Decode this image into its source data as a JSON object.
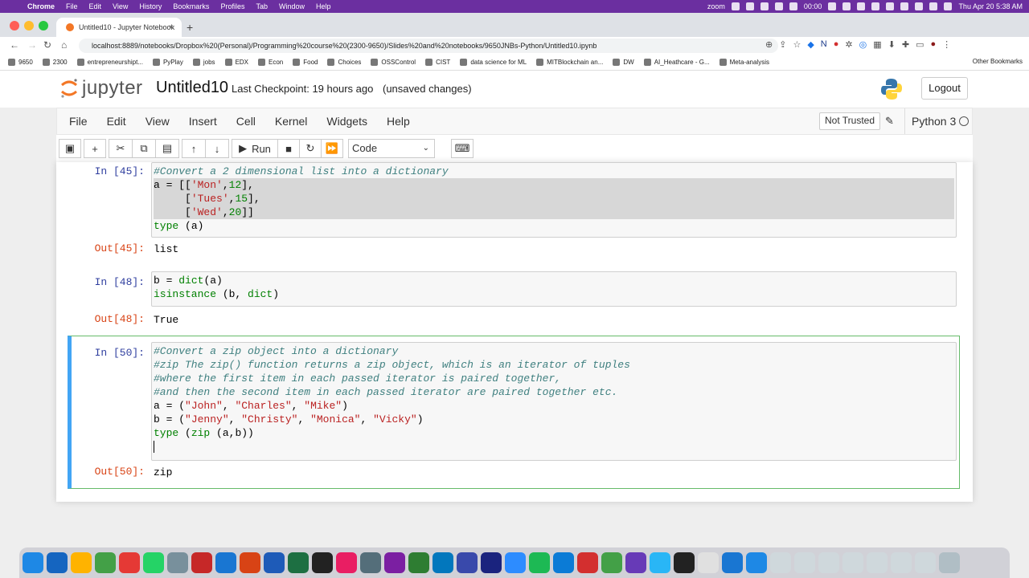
{
  "mac_menubar": {
    "app": "Chrome",
    "menus": [
      "File",
      "Edit",
      "View",
      "History",
      "Bookmarks",
      "Profiles",
      "Tab",
      "Window",
      "Help"
    ],
    "zoom_label": "zoom",
    "timer": "00:00",
    "datetime": "Thu Apr 20  5:38 AM"
  },
  "browser": {
    "tab_title": "Untitled10 - Jupyter Notebook",
    "url": "localhost:8889/notebooks/Dropbox%20(Personal)/Programming%20course%20(2300-9650)/Slides%20and%20notebooks/9650JNBs-Python/Untitled10.ipynb",
    "bookmarks": [
      "9650",
      "2300",
      "entrepreneurshipt...",
      "PyPlay",
      "jobs",
      "EDX",
      "Econ",
      "Food",
      "Choices",
      "OSSControl",
      "CIST",
      "data science for ML",
      "MITBlockchain an...",
      "DW",
      "AI_Heathcare - G...",
      "Meta-analysis"
    ],
    "other_bookmarks": "Other Bookmarks"
  },
  "jupyter": {
    "logo_text": "jupyter",
    "notebook_title": "Untitled10",
    "checkpoint": "Last Checkpoint: 19 hours ago",
    "unsaved": "(unsaved changes)",
    "logout_label": "Logout",
    "menu": [
      "File",
      "Edit",
      "View",
      "Insert",
      "Cell",
      "Kernel",
      "Widgets",
      "Help"
    ],
    "trusted_label": "Not Trusted",
    "kernel_name": "Python 3",
    "run_label": "Run",
    "cell_type": "Code"
  },
  "cells": [
    {
      "in_prompt": "In [45]:",
      "lines": [
        [
          {
            "t": "#Convert a 2 dimensional list into a dictionary",
            "c": "cm"
          }
        ],
        [
          {
            "t": "a = [[",
            "c": ""
          },
          {
            "t": "'Mon'",
            "c": "str"
          },
          {
            "t": ",",
            "c": ""
          },
          {
            "t": "12",
            "c": "num"
          },
          {
            "t": "],",
            "c": ""
          }
        ],
        [
          {
            "t": "     [",
            "c": ""
          },
          {
            "t": "'Tues'",
            "c": "str"
          },
          {
            "t": ",",
            "c": ""
          },
          {
            "t": "15",
            "c": "num"
          },
          {
            "t": "],",
            "c": ""
          }
        ],
        [
          {
            "t": "     [",
            "c": ""
          },
          {
            "t": "'Wed'",
            "c": "str"
          },
          {
            "t": ",",
            "c": ""
          },
          {
            "t": "20",
            "c": "num"
          },
          {
            "t": "]]",
            "c": ""
          }
        ],
        [
          {
            "t": "type",
            "c": "kw"
          },
          {
            "t": " (a)",
            "c": ""
          }
        ]
      ],
      "out_prompt": "Out[45]:",
      "output": "list"
    },
    {
      "in_prompt": "In [48]:",
      "lines": [
        [
          {
            "t": "b = ",
            "c": ""
          },
          {
            "t": "dict",
            "c": "kw"
          },
          {
            "t": "(a)",
            "c": ""
          }
        ],
        [
          {
            "t": "isinstance",
            "c": "kw"
          },
          {
            "t": " (b, ",
            "c": ""
          },
          {
            "t": "dict",
            "c": "kw"
          },
          {
            "t": ")",
            "c": ""
          }
        ]
      ],
      "out_prompt": "Out[48]:",
      "output": "True"
    },
    {
      "in_prompt": "In [50]:",
      "lines": [
        [
          {
            "t": "#Convert a zip object into a dictionary",
            "c": "cm"
          }
        ],
        [
          {
            "t": "#zip The zip() function returns a zip object, which is an iterator of tuples",
            "c": "cm"
          }
        ],
        [
          {
            "t": "#where the first item in each passed iterator is paired together,",
            "c": "cm"
          }
        ],
        [
          {
            "t": "#and then the second item in each passed iterator are paired together etc.",
            "c": "cm"
          }
        ],
        [
          {
            "t": "a = (",
            "c": ""
          },
          {
            "t": "\"John\"",
            "c": "str"
          },
          {
            "t": ", ",
            "c": ""
          },
          {
            "t": "\"Charles\"",
            "c": "str"
          },
          {
            "t": ", ",
            "c": ""
          },
          {
            "t": "\"Mike\"",
            "c": "str"
          },
          {
            "t": ")",
            "c": ""
          }
        ],
        [
          {
            "t": "b = (",
            "c": ""
          },
          {
            "t": "\"Jenny\"",
            "c": "str"
          },
          {
            "t": ", ",
            "c": ""
          },
          {
            "t": "\"Christy\"",
            "c": "str"
          },
          {
            "t": ", ",
            "c": ""
          },
          {
            "t": "\"Monica\"",
            "c": "str"
          },
          {
            "t": ", ",
            "c": ""
          },
          {
            "t": "\"Vicky\"",
            "c": "str"
          },
          {
            "t": ")",
            "c": ""
          }
        ],
        [
          {
            "t": "type",
            "c": "kw"
          },
          {
            "t": " (",
            "c": ""
          },
          {
            "t": "zip",
            "c": "kw"
          },
          {
            "t": " (a,b))",
            "c": ""
          }
        ],
        []
      ],
      "out_prompt": "Out[50]:",
      "output": "zip"
    }
  ],
  "colors": {
    "mac_menubar": "#6b2fa0",
    "in_prompt": "#303f9f",
    "out_prompt": "#d84315",
    "comment": "#408080",
    "string": "#ba2121",
    "keyword": "#008000",
    "edit_mode_border": "#66bb6a"
  }
}
